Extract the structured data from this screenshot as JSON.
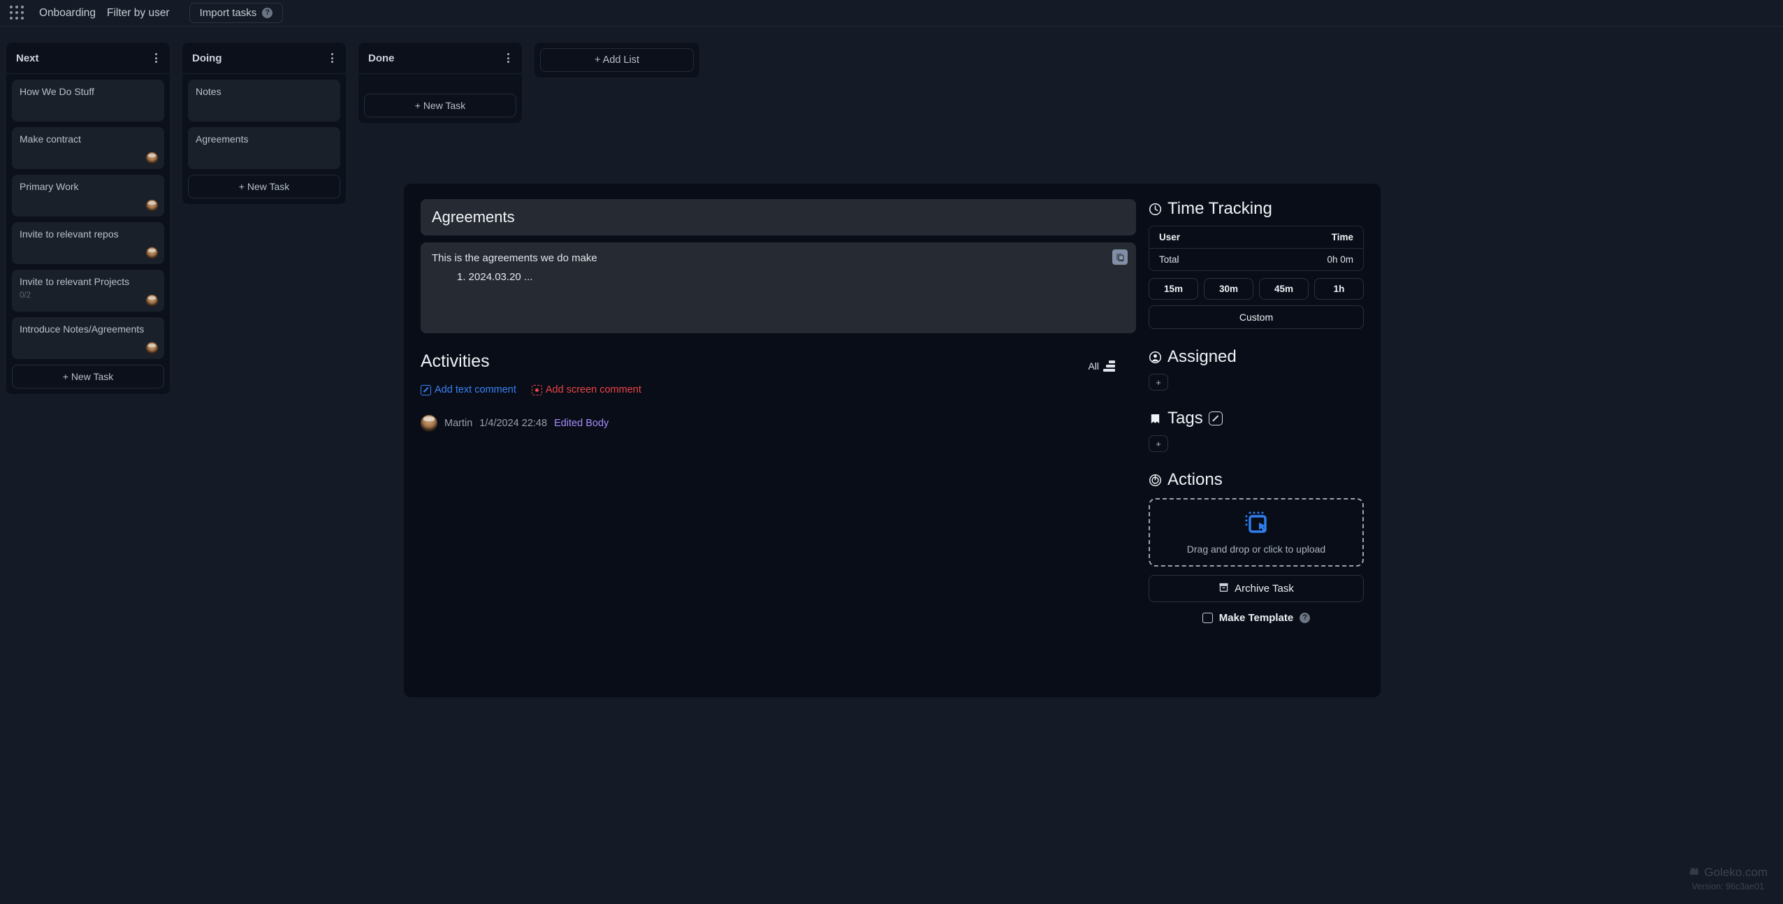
{
  "topbar": {
    "apps_icon": "grid-apps-icon",
    "project": "Onboarding",
    "filter": "Filter by user",
    "import_label": "Import tasks",
    "help_glyph": "?"
  },
  "board": {
    "add_list_label": "+ Add List",
    "lists": [
      {
        "title": "Next",
        "new_task_label": "+ New Task",
        "cards": [
          {
            "title": "How We Do Stuff",
            "sub": "",
            "avatar": false
          },
          {
            "title": "Make contract",
            "sub": "",
            "avatar": true
          },
          {
            "title": "Primary Work",
            "sub": "",
            "avatar": true
          },
          {
            "title": "Invite to relevant repos",
            "sub": "",
            "avatar": true
          },
          {
            "title": "Invite to relevant Projects",
            "sub": "0/2",
            "avatar": true
          },
          {
            "title": "Introduce Notes/Agreements",
            "sub": "",
            "avatar": true
          }
        ]
      },
      {
        "title": "Doing",
        "new_task_label": "+ New Task",
        "cards": [
          {
            "title": "Notes",
            "sub": "",
            "avatar": false
          },
          {
            "title": "Agreements",
            "sub": "",
            "avatar": false
          }
        ]
      },
      {
        "title": "Done",
        "new_task_label": "+ New Task",
        "cards": []
      }
    ]
  },
  "detail": {
    "task_title": "Agreements",
    "body_text": "This is the agreements we do make",
    "body_list_item": "1. 2024.03.20 ...",
    "copy_icon": "copy-icon",
    "activities": {
      "heading": "Activities",
      "filter_label": "All",
      "add_text_comment": "Add text comment",
      "add_screen_comment": "Add screen comment",
      "entries": [
        {
          "user": "Martin",
          "time": "1/4/2024 22:48",
          "action": "Edited Body"
        }
      ]
    }
  },
  "sidebar": {
    "time_tracking": {
      "heading": "Time Tracking",
      "col_user": "User",
      "col_time": "Time",
      "total_label": "Total",
      "total_value": "0h 0m",
      "quick": [
        "15m",
        "30m",
        "45m",
        "1h"
      ],
      "custom_label": "Custom"
    },
    "assigned": {
      "heading": "Assigned",
      "add_label": "+"
    },
    "tags": {
      "heading": "Tags",
      "add_label": "+"
    },
    "actions": {
      "heading": "Actions",
      "dropzone_label": "Drag and drop or click to upload",
      "archive_label": "Archive Task",
      "make_template_label": "Make Template",
      "help_glyph": "?"
    }
  },
  "watermark": {
    "brand": "Goleko.com",
    "version": "Version: 96c3ae01"
  },
  "colors": {
    "page_bg": "#141b26",
    "panel_bg": "#080d17",
    "list_bg": "#0b101a",
    "card_bg": "#1a202a",
    "box_bg": "#262b33",
    "accent_blue": "#3b82f6",
    "accent_red": "#ef4444",
    "accent_purple": "#a78bfa"
  }
}
